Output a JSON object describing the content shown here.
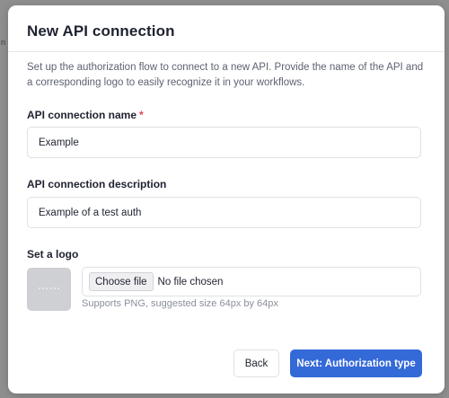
{
  "backdrop": {
    "edge_glyph": "n"
  },
  "dialog": {
    "title": "New API connection",
    "description": "Set up the authorization flow to connect to a new API. Provide the name of the API and a corresponding logo to easily recognize it in your workflows."
  },
  "fields": {
    "name": {
      "label": "API connection name",
      "required_marker": "*",
      "value": "Example"
    },
    "description": {
      "label": "API connection description",
      "value": "Example of a test auth"
    },
    "logo": {
      "label": "Set a logo",
      "choose_file_label": "Choose file",
      "status_text": "No file chosen",
      "hint": "Supports PNG, suggested size 64px by 64px"
    }
  },
  "footer": {
    "back_label": "Back",
    "next_label": "Next: Authorization type"
  },
  "colors": {
    "primary": "#3469d8",
    "required": "#e0414d",
    "backdrop": "#8e8e8e"
  }
}
